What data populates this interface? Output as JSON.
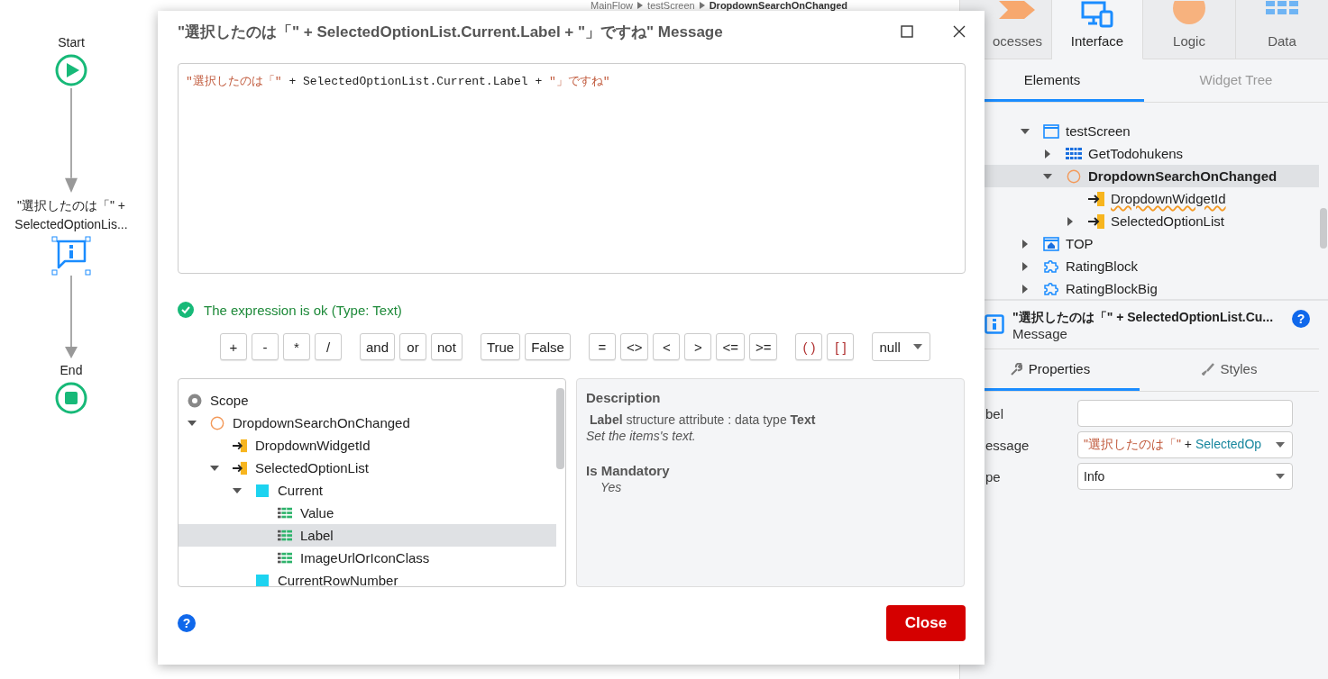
{
  "breadcrumb": [
    "MainFlow",
    "testScreen",
    "DropdownSearchOnChanged"
  ],
  "flow": [
    {
      "kind": "start",
      "label": "Start",
      "selected": false
    },
    {
      "kind": "message",
      "label": "\"選択したのは「\" + SelectedOptionLis...",
      "selected": true
    },
    {
      "kind": "end",
      "label": "End",
      "selected": false
    }
  ],
  "side_tabs": [
    {
      "label": "ocesses",
      "kind": "processes",
      "selected": false
    },
    {
      "label": "Interface",
      "kind": "interface",
      "selected": true
    },
    {
      "label": "Logic",
      "kind": "logic",
      "selected": false
    },
    {
      "label": "Data",
      "kind": "data",
      "selected": false
    }
  ],
  "sub_tabs": [
    {
      "label": "Elements",
      "selected": true
    },
    {
      "label": "Widget Tree",
      "selected": false
    }
  ],
  "element_tree": [
    {
      "label": "testScreen",
      "kind": "screen",
      "expanded": true,
      "selected": false,
      "warning": false,
      "children": [
        {
          "label": "GetTodohukens",
          "kind": "aggregate",
          "expanded": false,
          "selected": false,
          "warning": false
        },
        {
          "label": "DropdownSearchOnChanged",
          "kind": "action",
          "expanded": true,
          "selected": true,
          "warning": false,
          "children": [
            {
              "label": "DropdownWidgetId",
              "kind": "input",
              "selected": false,
              "warning": true
            },
            {
              "label": "SelectedOptionList",
              "kind": "input",
              "expanded": false,
              "selected": false,
              "warning": false
            }
          ]
        }
      ]
    },
    {
      "label": "TOP",
      "kind": "home",
      "expanded": false,
      "selected": false,
      "warning": false
    },
    {
      "label": "RatingBlock",
      "kind": "block",
      "expanded": false,
      "selected": false,
      "warning": false
    },
    {
      "label": "RatingBlockBig",
      "kind": "block",
      "expanded": false,
      "selected": false,
      "warning": false
    }
  ],
  "element_info": {
    "title": "\"選択したのは「\" + SelectedOptionList.Cu...",
    "type": "Message",
    "help": "?"
  },
  "prop_tabs": [
    {
      "label": "Properties",
      "kind": "wrench",
      "selected": true
    },
    {
      "label": "Styles",
      "kind": "brush",
      "selected": false
    }
  ],
  "properties": [
    {
      "label": "bel",
      "kind": "input"
    },
    {
      "label": "essage",
      "kind": "select",
      "tokens": [
        {
          "kind": "string",
          "text": "\"選択したのは「\""
        },
        {
          "kind": "plain",
          "text": " + "
        },
        {
          "kind": "ident",
          "text": "SelectedOp"
        }
      ]
    },
    {
      "label": "pe",
      "kind": "select",
      "tokens": [
        {
          "kind": "plain",
          "text": "Info"
        }
      ]
    }
  ],
  "dialog": {
    "title": "\"選択したのは「\" + SelectedOptionList.Current.Label + \"」ですね\" Message",
    "expression": [
      {
        "kind": "string",
        "text": "\"選択したのは「\""
      },
      {
        "kind": "code",
        "text": " + SelectedOptionList.Current.Label + "
      },
      {
        "kind": "string",
        "text": "\"」ですね\""
      }
    ],
    "status": "The expression is ok (Type: Text)",
    "operator_groups": [
      [
        "+",
        "-",
        "*",
        "/"
      ],
      [
        "and",
        "or",
        "not"
      ],
      [
        "True",
        "False"
      ],
      [
        "=",
        "<>",
        "<",
        ">",
        "<=",
        ">="
      ],
      [
        "( )",
        "[ ]"
      ]
    ],
    "null_dropdown": "null",
    "scope_label": "Scope",
    "scope_tree": [
      {
        "label": "DropdownSearchOnChanged",
        "kind": "action",
        "expanded": true,
        "selected": false,
        "children": [
          {
            "label": "DropdownWidgetId",
            "kind": "input",
            "selected": false
          },
          {
            "label": "SelectedOptionList",
            "kind": "input",
            "expanded": true,
            "selected": false,
            "children": [
              {
                "label": "Current",
                "kind": "record",
                "expanded": true,
                "selected": false,
                "children": [
                  {
                    "label": "Value",
                    "kind": "attribute",
                    "selected": false
                  },
                  {
                    "label": "Label",
                    "kind": "attribute",
                    "selected": true
                  },
                  {
                    "label": "ImageUrlOrIconClass",
                    "kind": "attribute",
                    "selected": false
                  }
                ]
              },
              {
                "label": "CurrentRowNumber",
                "kind": "record",
                "selected": false
              }
            ]
          }
        ]
      }
    ],
    "description": {
      "heading": "Description",
      "summary": "**Label** structure attribute : data type **Text**",
      "note": "Set the items's text.",
      "mandatory_heading": "Is Mandatory",
      "mandatory_value": "Yes"
    },
    "help": "?",
    "close_button": "Close"
  }
}
